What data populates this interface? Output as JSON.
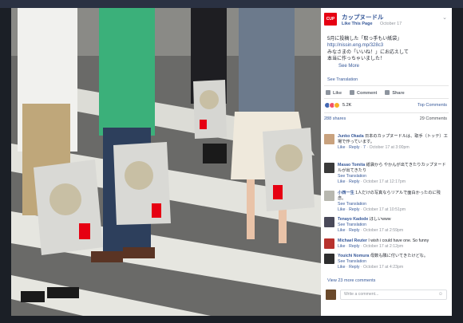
{
  "page": {
    "name": "カップヌードル",
    "logo_text": "CUP NOODLE",
    "like_page": "Like This Page",
    "date": "October 17"
  },
  "post": {
    "lines": [
      "5月に投稿した「取っ手もい紙袋」",
      "http://nissin.eng.mp/328c3",
      "みなさまの「いいね！」にお応えして",
      "本当に作っちゃいました！"
    ],
    "see_more": "See More",
    "see_translation": "See Translation"
  },
  "actions": {
    "like": "Like",
    "comment": "Comment",
    "share": "Share"
  },
  "reactions": {
    "count": "5.2K",
    "top_comments": "Top Comments"
  },
  "stats": {
    "shares": "288 shares",
    "comments": "29 Comments"
  },
  "comments": [
    {
      "name": "Junko Okada",
      "text": "日本のカップヌードルは、取手（トッテ）工場で作っています。",
      "translate": "",
      "meta": "October 17 at 3:00pm",
      "extra": "7",
      "avatar_color": "#c9a27e"
    },
    {
      "name": "Masao Tomita",
      "text": "紙袋から やかんが出てきたりカップヌードルが出てきたり",
      "translate": "See Translation",
      "meta": "October 17 at 12:17pm",
      "extra": "",
      "avatar_color": "#3a3a3a"
    },
    {
      "name": "小西一生",
      "text": "1人だけの写真ならリアルで面白かったのに残念。",
      "translate": "See Translation",
      "meta": "October 17 at 10:51pm",
      "extra": "",
      "avatar_color": "#b8b8b0"
    },
    {
      "name": "Tenayo Kadode",
      "text": "ほしいwww",
      "translate": "See Translation",
      "meta": "October 17 at 2:59pm",
      "extra": "",
      "avatar_color": "#4a4a5a"
    },
    {
      "name": "Michael Reuter",
      "text": "I wish i could have one. So funny",
      "translate": "",
      "meta": "October 17 at 2:12pm",
      "extra": "",
      "avatar_color": "#b8322e"
    },
    {
      "name": "Youichi Nomura",
      "text": "母数も隣に付いてきたけどな。",
      "translate": "See Translation",
      "meta": "October 17 at 4:23pm",
      "extra": "",
      "avatar_color": "#2e2e2e"
    }
  ],
  "comment_actions": {
    "like": "Like",
    "reply": "Reply"
  },
  "view_more": "View 23 more comments",
  "write_placeholder": "Write a comment...",
  "colors": {
    "link": "#365899",
    "brand_red": "#e60012",
    "backdrop": "#1b1f26"
  }
}
